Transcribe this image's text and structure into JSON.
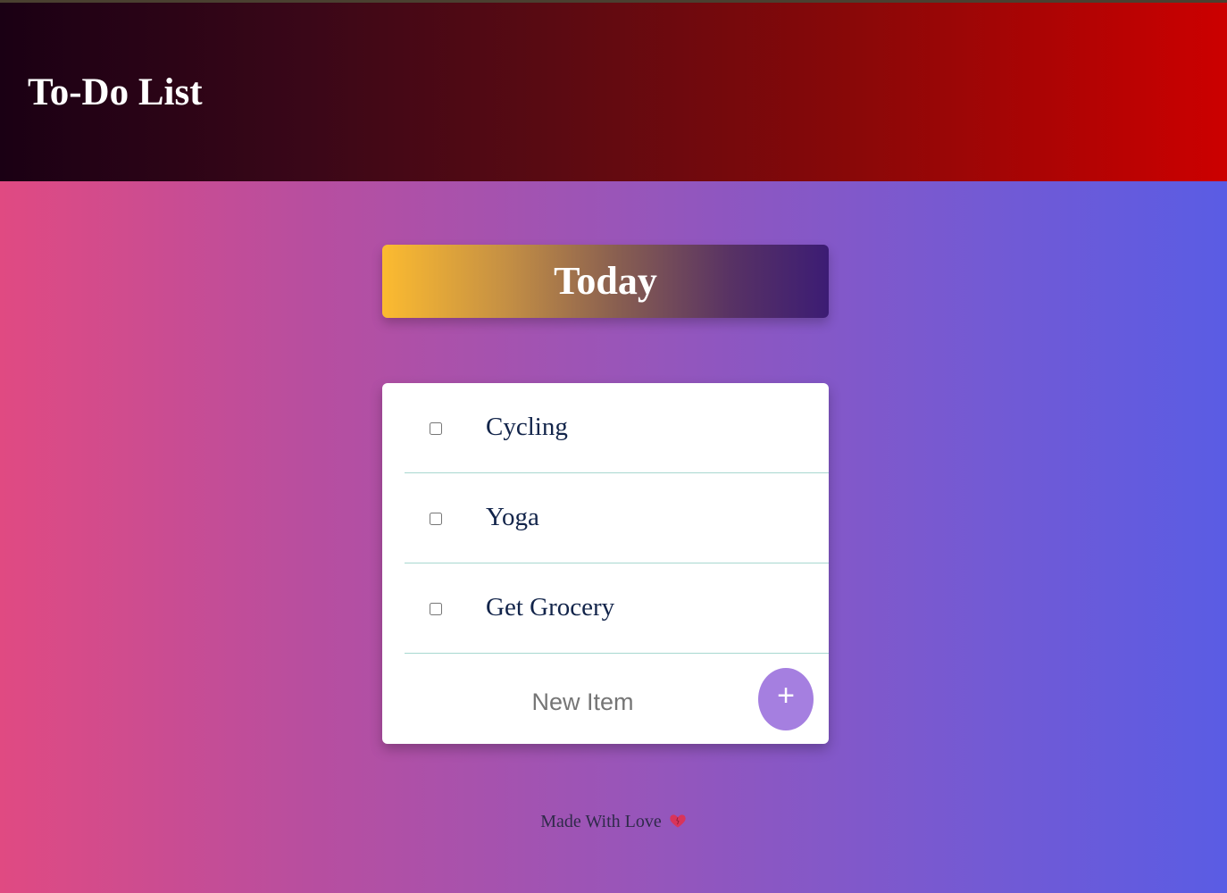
{
  "header": {
    "title": "To-Do List"
  },
  "day_heading": "Today",
  "todo_items": [
    {
      "label": "Cycling",
      "checked": false
    },
    {
      "label": "Yoga",
      "checked": false
    },
    {
      "label": "Get Grocery",
      "checked": false
    }
  ],
  "new_item": {
    "placeholder": "New Item",
    "value": "",
    "add_button_label": "+"
  },
  "footer": {
    "text": "Made With Love",
    "icon": "heart-icon"
  },
  "colors": {
    "add_button": "#a57fe0",
    "item_text": "#12244a",
    "divider": "#a8d8d0",
    "heart": "#d9345a"
  }
}
